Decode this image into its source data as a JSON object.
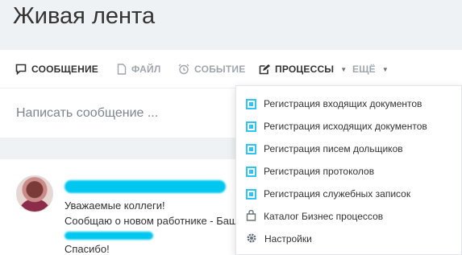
{
  "header": {
    "title": "Живая лента"
  },
  "composer": {
    "tabs": [
      {
        "label": "СООБЩЕНИЕ",
        "icon": "message-icon"
      },
      {
        "label": "ФАЙЛ",
        "icon": "file-icon"
      },
      {
        "label": "СОБЫТИЕ",
        "icon": "alarm-clock-icon"
      },
      {
        "label": "ПРОЦЕССЫ",
        "icon": "edit-icon"
      },
      {
        "label": "ЕЩЁ"
      }
    ],
    "placeholder": "Написать сообщение ..."
  },
  "post": {
    "lines": [
      "Уважаемые коллеги!",
      "Сообщаю о новом работнике - Баш",
      "Спасибо!"
    ]
  },
  "processes_menu": {
    "items": [
      {
        "label": "Регистрация входящих документов",
        "icon": "business-process-icon"
      },
      {
        "label": "Регистрация исходящих документов",
        "icon": "business-process-icon"
      },
      {
        "label": "Регистрация писем дольщиков",
        "icon": "business-process-icon"
      },
      {
        "label": "Регистрация протоколов",
        "icon": "business-process-icon"
      },
      {
        "label": "Регистрация служебных записок",
        "icon": "business-process-icon"
      },
      {
        "label": "Каталог Бизнес процессов",
        "icon": "shopping-bag-icon"
      },
      {
        "label": "Настройки",
        "icon": "gear-icon"
      }
    ]
  },
  "colors": {
    "accent": "#2fc6f6",
    "redacted": "#00c7ef"
  }
}
